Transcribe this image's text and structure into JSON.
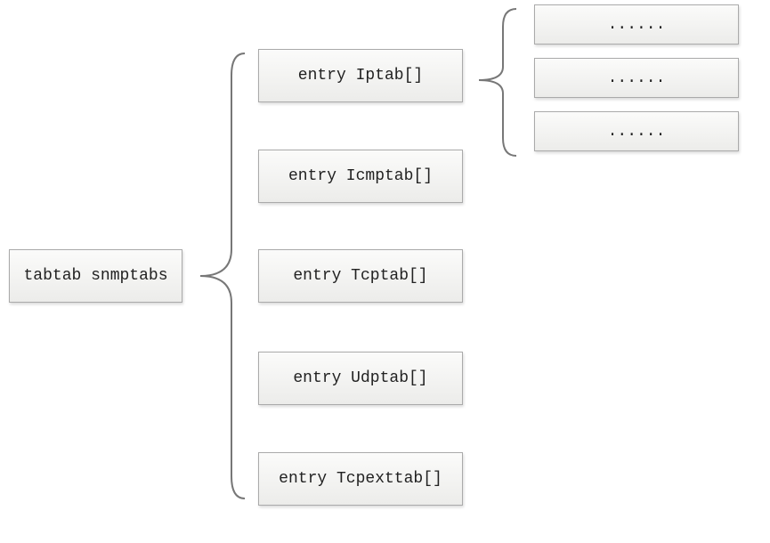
{
  "root": {
    "label": "tabtab snmptabs"
  },
  "entries": [
    {
      "label": "entry Iptab[]"
    },
    {
      "label": "entry Icmptab[]"
    },
    {
      "label": "entry Tcptab[]"
    },
    {
      "label": "entry Udptab[]"
    },
    {
      "label": "entry Tcpexttab[]"
    }
  ],
  "sub_entries": [
    {
      "label": "......"
    },
    {
      "label": "......"
    },
    {
      "label": "......"
    }
  ]
}
